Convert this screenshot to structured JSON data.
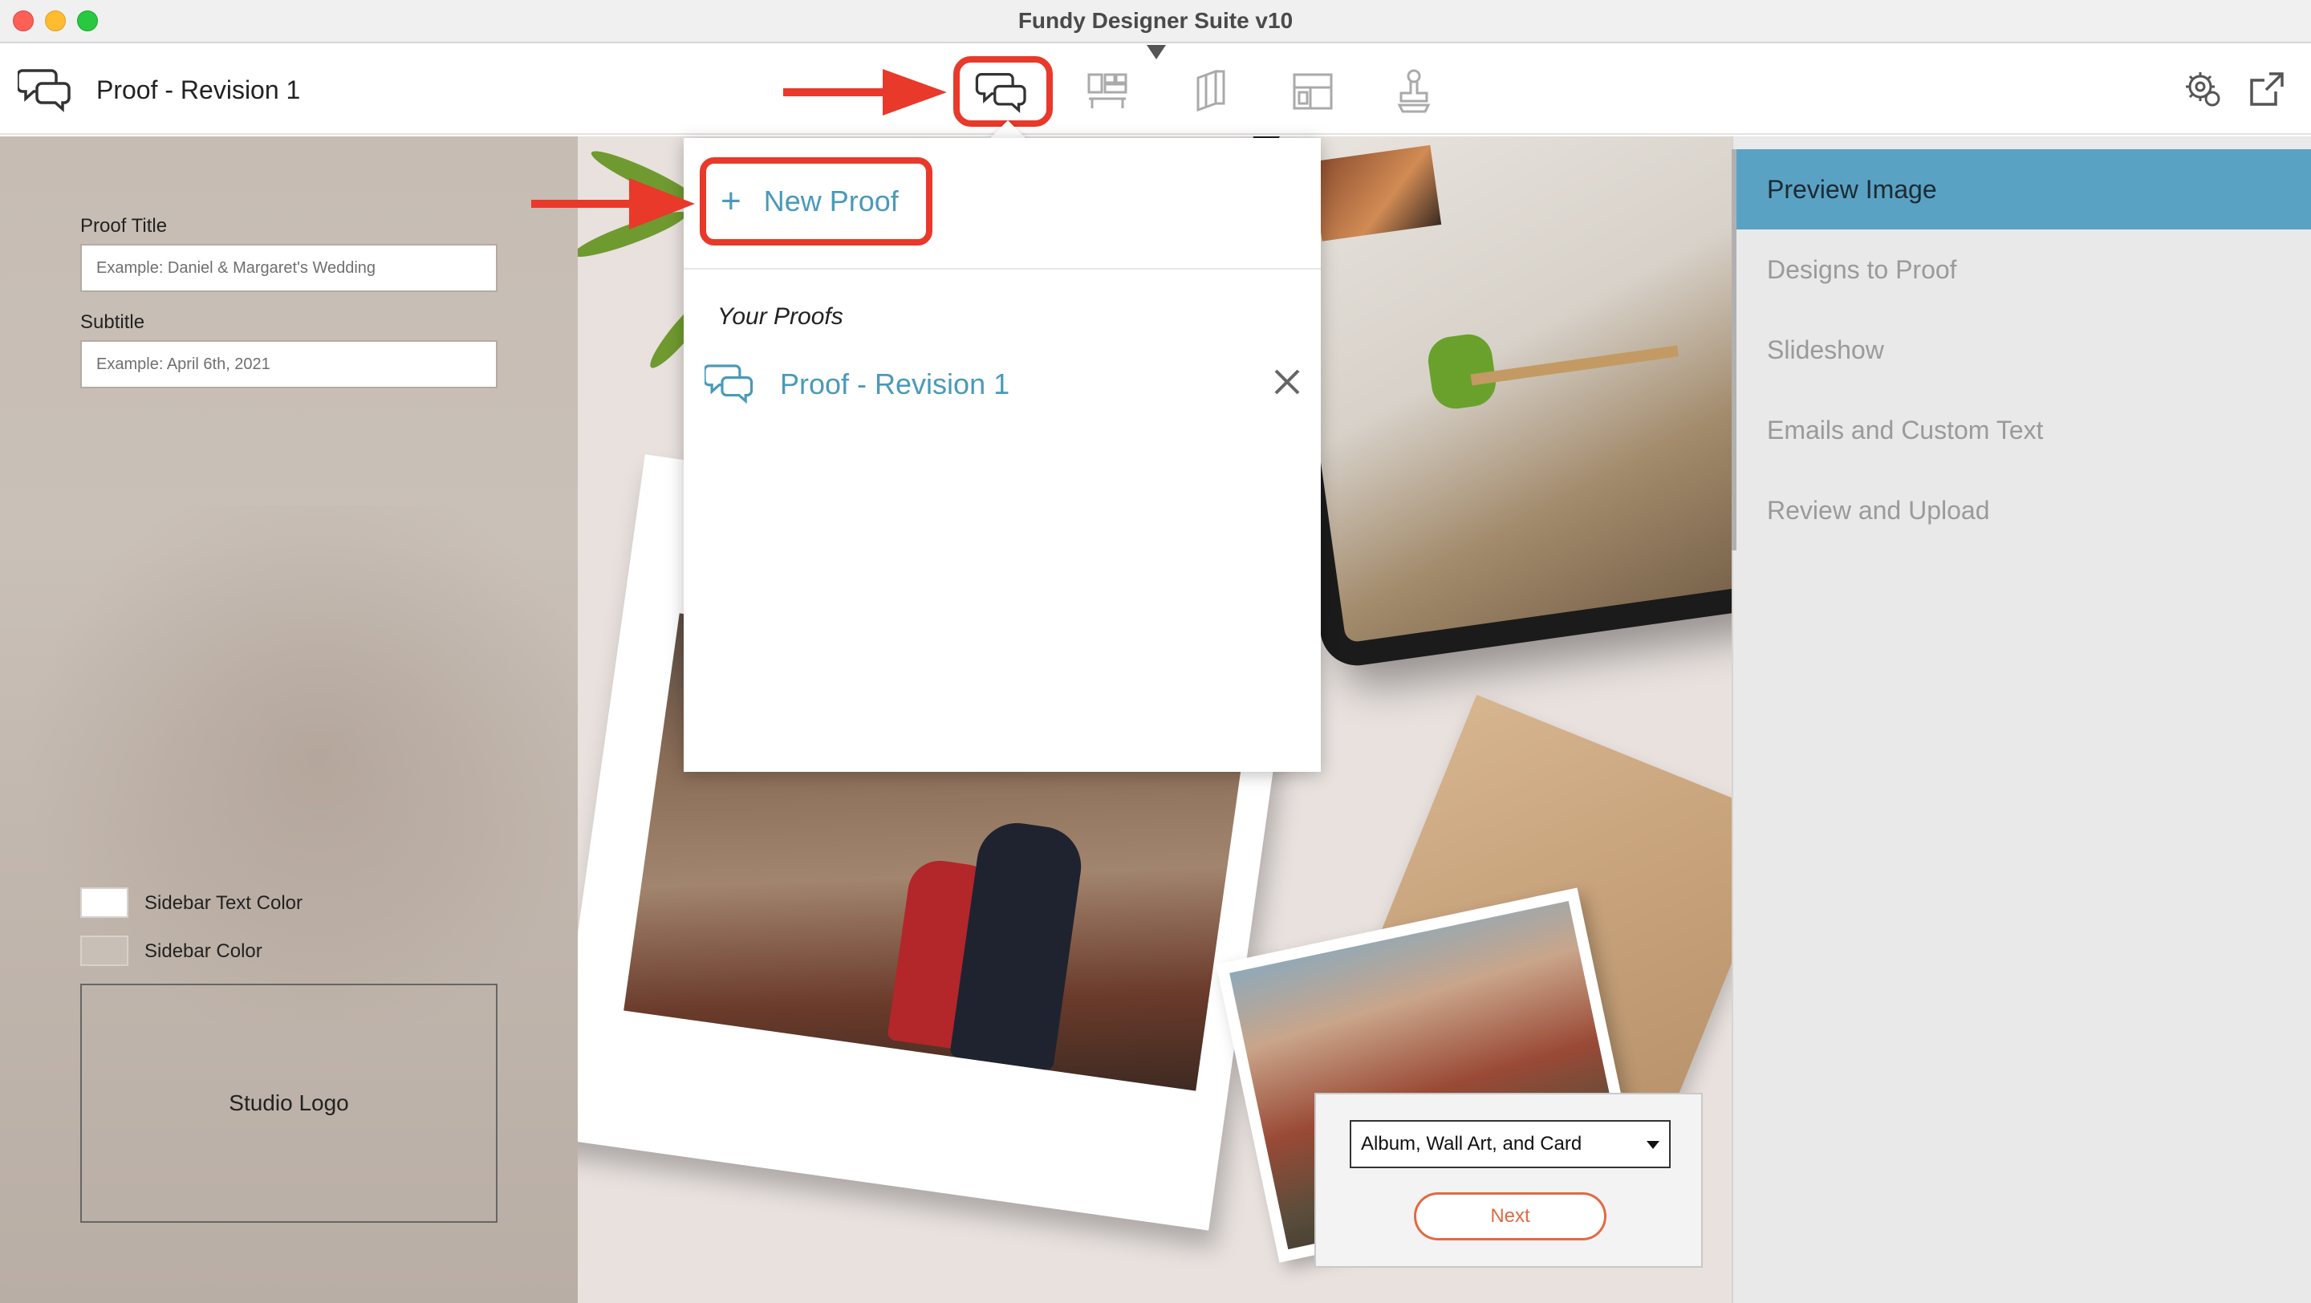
{
  "window": {
    "title": "Fundy Designer Suite v10"
  },
  "toolbar": {
    "doc_title": "Proof - Revision 1",
    "tools": [
      {
        "icon": "proof-chat-icon",
        "active": true
      },
      {
        "icon": "album-layout-icon"
      },
      {
        "icon": "card-pages-icon"
      },
      {
        "icon": "wall-art-icon"
      },
      {
        "icon": "stamp-icon"
      }
    ],
    "right_tools": [
      {
        "icon": "settings-gear-icon"
      },
      {
        "icon": "open-external-icon"
      }
    ]
  },
  "left_panel": {
    "proof_title_label": "Proof Title",
    "proof_title_placeholder": "Example: Daniel & Margaret's Wedding",
    "subtitle_label": "Subtitle",
    "subtitle_placeholder": "Example: April 6th, 2021",
    "sidebar_text_color_label": "Sidebar Text Color",
    "sidebar_color_label": "Sidebar Color",
    "studio_logo_label": "Studio Logo"
  },
  "popover": {
    "new_proof_label": "New Proof",
    "your_proofs_heading": "Your Proofs",
    "proofs": [
      {
        "label": "Proof - Revision 1"
      }
    ]
  },
  "preview": {
    "product_select_value": "Album, Wall Art, and Card",
    "next_label": "Next"
  },
  "right_nav": {
    "items": [
      {
        "label": "Preview Image",
        "active": true
      },
      {
        "label": "Designs to Proof"
      },
      {
        "label": "Slideshow"
      },
      {
        "label": "Emails and Custom Text"
      },
      {
        "label": "Review and Upload"
      }
    ]
  },
  "colors": {
    "accent_blue": "#5aa2c3",
    "link_blue": "#4a9ab8",
    "annotation_red": "#e8392a",
    "next_orange": "#e06a44"
  }
}
